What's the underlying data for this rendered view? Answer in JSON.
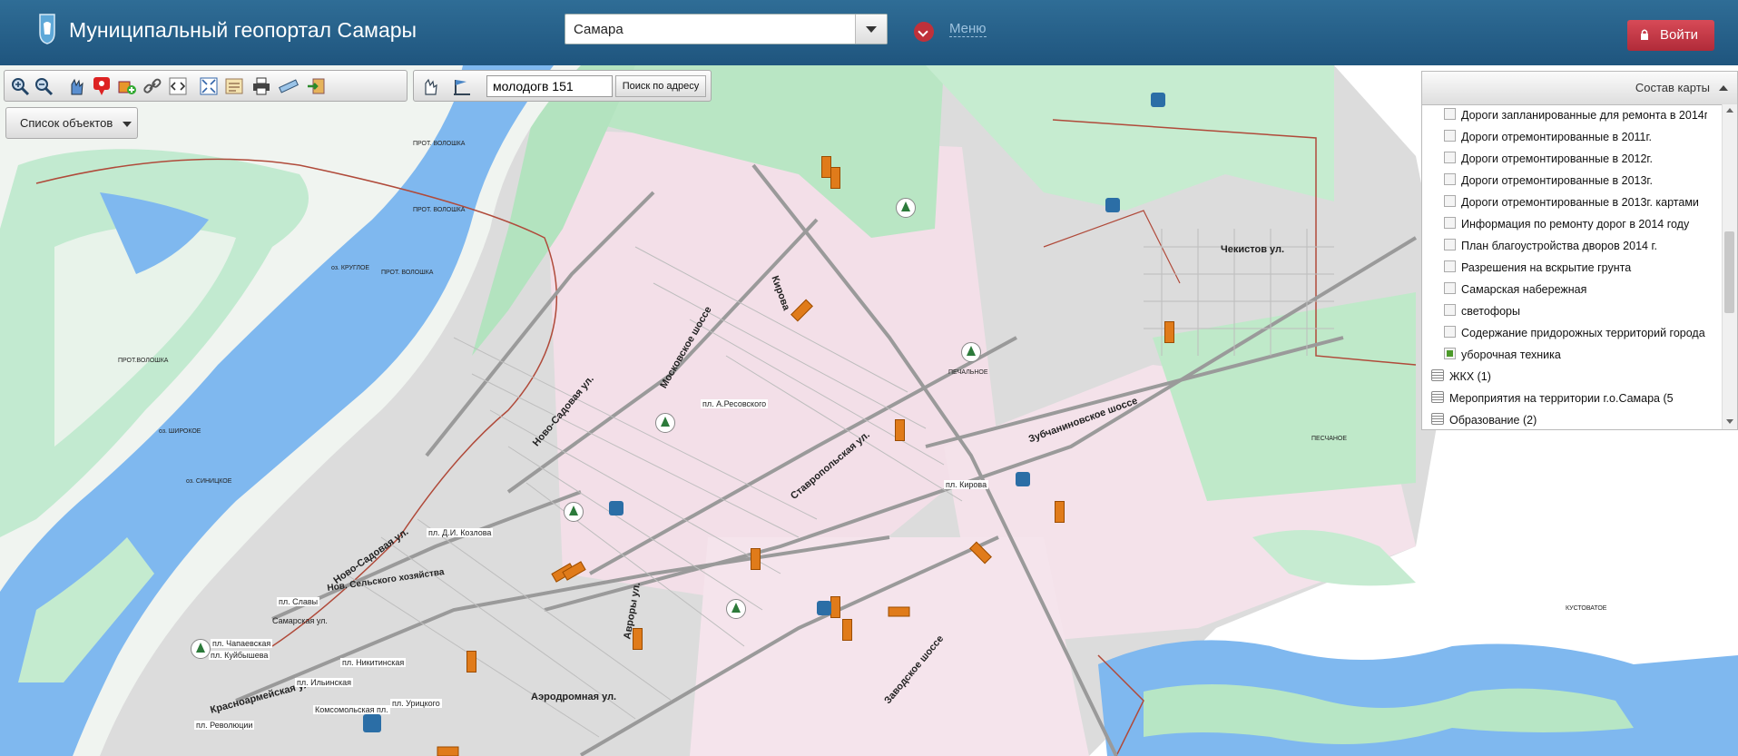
{
  "header": {
    "title": "Муниципальный геопортал Самары",
    "city_value": "Самара",
    "menu_label": "Меню",
    "login_label": "Войти"
  },
  "toolbar": {
    "address_value": "молодогв 151",
    "address_search_label": "Поиск по адресу",
    "tools": [
      "zoom-in-icon",
      "zoom-out-icon",
      "pan-icon",
      "marker-icon",
      "add-layer-icon",
      "link-icon",
      "embed-icon",
      "fullscreen-icon",
      "legend-icon",
      "print-icon",
      "ruler-icon",
      "export-icon"
    ],
    "tools2": [
      "select-icon",
      "measure-icon"
    ]
  },
  "object_list": {
    "label": "Список объектов"
  },
  "layers_panel": {
    "title": "Состав карты",
    "layers": [
      {
        "label": "Дороги запланированные для ремонта в 2014г.",
        "checked": false
      },
      {
        "label": "Дороги отремонтированные в 2011г.",
        "checked": false
      },
      {
        "label": "Дороги отремонтированные в 2012г.",
        "checked": false
      },
      {
        "label": "Дороги отремонтированные в 2013г.",
        "checked": false
      },
      {
        "label": "Дороги отремонтированные в 2013г. картами",
        "checked": false
      },
      {
        "label": "Информация по ремонту дорог  в 2014 году",
        "checked": false
      },
      {
        "label": "План благоустройства дворов 2014 г.",
        "checked": false
      },
      {
        "label": "Разрешения на вскрытие грунта",
        "checked": false
      },
      {
        "label": "Самарская набережная",
        "checked": false
      },
      {
        "label": "светофоры",
        "checked": false
      },
      {
        "label": "Содержание придорожных территорий города",
        "checked": false
      },
      {
        "label": "уборочная техника",
        "checked": true
      }
    ],
    "groups": [
      {
        "label": "ЖКХ (1)"
      },
      {
        "label": "Мероприятия на территории г.о.Самара (5"
      },
      {
        "label": "Образование (2)"
      }
    ]
  },
  "map_labels": {
    "l1": "Ново-Садовая ул.",
    "l2": "Московское шоссе",
    "l3": "Кирова",
    "l4": "Ставропольская ул.",
    "l5": "Зубчаниновское шоссе",
    "l6": "Чекистов ул.",
    "l7": "Ново-Садовая ул.",
    "l8": "Аэродромная ул.",
    "l9": "Заводское шоссе",
    "l10": "Красноармейская ул.",
    "l11": "пл. А.Ресовского",
    "l12": "пл. Д.И. Козлова",
    "l13": "пл. Кирова",
    "l14": "пл. Чапаевская",
    "l15": "пл. Куйбышева",
    "l16": "пл. Никитинская",
    "l17": "пл. Ильинская",
    "l18": "пл. Урицкого",
    "l19": "Комсомольская пл.",
    "l20": "пл. Революции",
    "l21": "Нов. Сельского хозяйства",
    "l22": "Самарская ул.",
    "l23": "Авроры ул.",
    "l24": "пл. Славы",
    "l25": "ПРОТ. ВОЛОШКА",
    "l26": "ПРОТ. ВОЛОШКА",
    "l27": "ПРОТ. ВОЛОШКА",
    "l28": "ПЕЧАЛЬНОЕ",
    "l29": "КУСТОВАТОЕ",
    "l30": "ПЕСЧАНОЕ",
    "l31": "ПРОТ.ВОЛОШКА",
    "l32": "оз. ШИРОКОЕ",
    "l33": "оз. СИНИЦКОЕ",
    "l34": "оз. КРУГЛОЕ"
  }
}
